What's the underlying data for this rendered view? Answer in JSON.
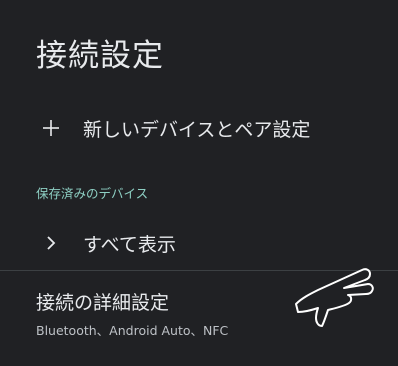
{
  "header": {
    "title": "接続設定"
  },
  "pair_new_device": {
    "icon": "plus-icon",
    "label": "新しいデバイスとペア設定"
  },
  "saved_devices": {
    "section_header": "保存済みのデバイス",
    "see_all": {
      "icon": "chevron-right-icon",
      "label": "すべて表示"
    }
  },
  "advanced": {
    "title": "接続の詳細設定",
    "summary": "Bluetooth、Android Auto、NFC"
  },
  "gesture_hint": {
    "icon": "pointing-hand-icon"
  }
}
